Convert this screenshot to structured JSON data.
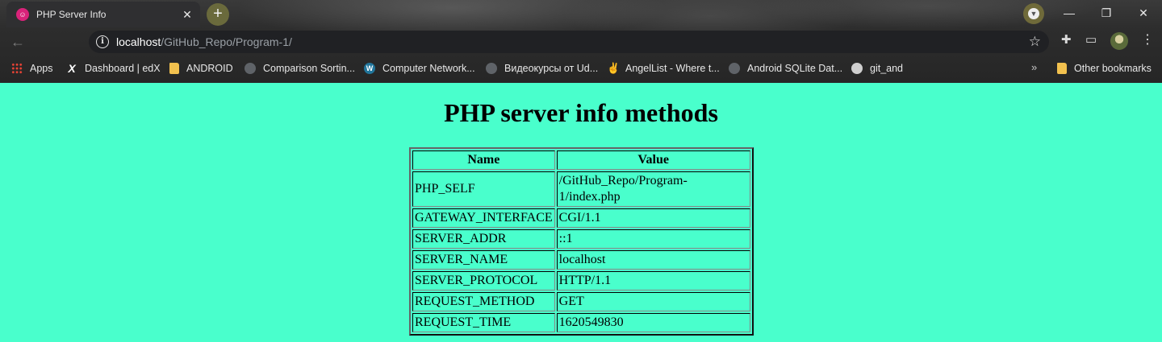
{
  "browser": {
    "tab": {
      "title": "PHP Server Info",
      "favicon": "php-favicon-icon"
    },
    "url": {
      "host": "localhost",
      "path": "/GitHub_Repo/Program-1/"
    },
    "bookmarks": [
      {
        "label": "Apps",
        "icon": "apps-icon"
      },
      {
        "label": "Dashboard | edX",
        "icon": "edx-icon"
      },
      {
        "label": "ANDROID",
        "icon": "folder-icon"
      },
      {
        "label": "Comparison Sortin...",
        "icon": "globe-icon"
      },
      {
        "label": "Computer Network...",
        "icon": "wordpress-icon"
      },
      {
        "label": "Видеокурсы от Ud...",
        "icon": "globe-icon"
      },
      {
        "label": "AngelList - Where t...",
        "icon": "angellist-icon"
      },
      {
        "label": "Android SQLite Dat...",
        "icon": "globe-icon"
      },
      {
        "label": "git_and",
        "icon": "github-icon"
      }
    ],
    "other_bookmarks": "Other bookmarks"
  },
  "page": {
    "title": "PHP server info methods",
    "background": "#49ffcc",
    "table": {
      "headers": [
        "Name",
        "Value"
      ],
      "rows": [
        {
          "name": "PHP_SELF",
          "value": "/GitHub_Repo/Program-1/index.php"
        },
        {
          "name": "GATEWAY_INTERFACE",
          "value": "CGI/1.1"
        },
        {
          "name": "SERVER_ADDR",
          "value": "::1"
        },
        {
          "name": "SERVER_NAME",
          "value": "localhost"
        },
        {
          "name": "SERVER_PROTOCOL",
          "value": "HTTP/1.1"
        },
        {
          "name": "REQUEST_METHOD",
          "value": "GET"
        },
        {
          "name": "REQUEST_TIME",
          "value": "1620549830"
        }
      ]
    }
  }
}
